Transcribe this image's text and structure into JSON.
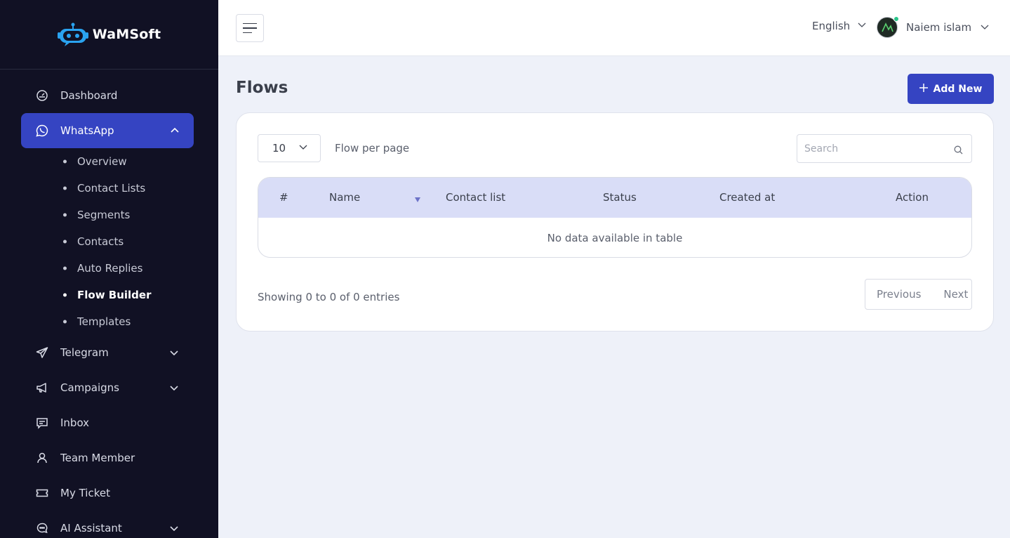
{
  "brand": {
    "name": "WaMSoft"
  },
  "sidebar": {
    "items": [
      {
        "label": "Dashboard",
        "icon": "gauge-icon"
      },
      {
        "label": "WhatsApp",
        "icon": "whatsapp-icon",
        "expanded": true
      },
      {
        "label": "Telegram",
        "icon": "telegram-icon"
      },
      {
        "label": "Campaigns",
        "icon": "megaphone-icon"
      },
      {
        "label": "Inbox",
        "icon": "message-icon"
      },
      {
        "label": "Team Member",
        "icon": "user-icon"
      },
      {
        "label": "My Ticket",
        "icon": "ticket-icon"
      },
      {
        "label": "AI Assistant",
        "icon": "chat-bot-icon"
      }
    ],
    "whatsapp_sub": [
      "Overview",
      "Contact Lists",
      "Segments",
      "Contacts",
      "Auto Replies",
      "Flow Builder",
      "Templates"
    ],
    "current_sub": "Flow Builder"
  },
  "header": {
    "language": "English",
    "user_name": "Naiem islam"
  },
  "page": {
    "title": "Flows",
    "add_label": "Add New"
  },
  "table_controls": {
    "per_page_value": "10",
    "per_page_label": "Flow per page",
    "search_placeholder": "Search"
  },
  "table": {
    "columns": [
      "#",
      "Name",
      "Contact list",
      "Status",
      "Created at",
      "Action"
    ],
    "empty_text": "No data available in table"
  },
  "footer": {
    "showing": "Showing 0 to 0 of 0 entries",
    "previous": "Previous",
    "next": "Next"
  },
  "colors": {
    "sidebar_bg": "#111124",
    "accent": "#3544c2",
    "table_header_bg": "#d9ddf7",
    "page_bg": "#eef1f9"
  }
}
